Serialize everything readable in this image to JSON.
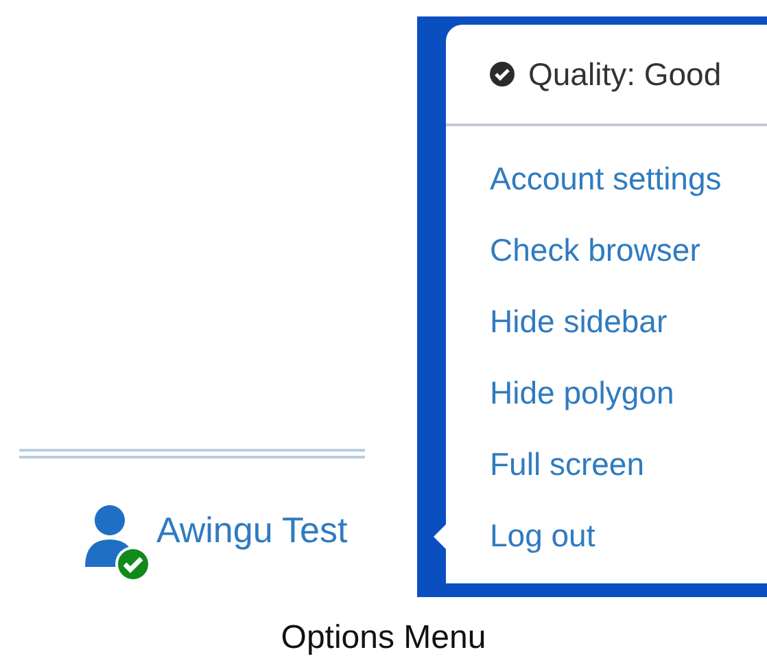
{
  "user": {
    "name": "Awingu Test",
    "online": true
  },
  "menu": {
    "status": "Quality: Good",
    "items": [
      {
        "label": "Account settings"
      },
      {
        "label": "Check browser"
      },
      {
        "label": "Hide sidebar"
      },
      {
        "label": "Hide polygon"
      },
      {
        "label": "Full screen"
      },
      {
        "label": "Log out"
      }
    ]
  },
  "caption": "Options Menu"
}
